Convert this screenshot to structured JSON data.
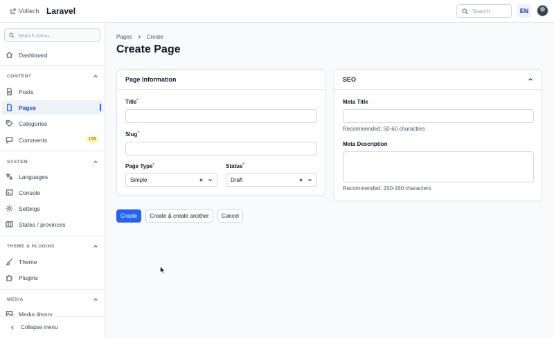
{
  "topbar": {
    "site_link": "Voltech",
    "brand": "Laravel",
    "search_placeholder": "Search",
    "language": "EN"
  },
  "sidebar": {
    "search_placeholder": "Search menu...",
    "dashboard": "Dashboard",
    "groups": {
      "content": "CONTENT",
      "system": "SYSTEM",
      "theme": "THEME & PLUGINS",
      "media": "MEDIA"
    },
    "items": {
      "posts": "Posts",
      "pages": "Pages",
      "categories": "Categories",
      "comments": "Comments",
      "comments_count": "156",
      "languages": "Languages",
      "console": "Console",
      "settings": "Settings",
      "states": "States / provinces",
      "theme": "Theme",
      "plugins": "Plugins",
      "media_library": "Media library"
    },
    "collapse": "Collapse menu"
  },
  "breadcrumb": {
    "parent": "Pages",
    "current": "Create"
  },
  "page_title": "Create Page",
  "page_info": {
    "heading": "Page Information",
    "title_label": "Title",
    "title_value": "",
    "slug_label": "Slug",
    "slug_value": "",
    "required_mark": "*",
    "page_type_label": "Page Type",
    "page_type_value": "Simple",
    "status_label": "Status",
    "status_value": "Draft"
  },
  "seo": {
    "heading": "SEO",
    "meta_title_label": "Meta Title",
    "meta_title_hint": "Recommended: 50-60 characters",
    "meta_desc_label": "Meta Description",
    "meta_desc_hint": "Recommended: 150-160 characters"
  },
  "actions": {
    "create": "Create",
    "create_another": "Create & create another",
    "cancel": "Cancel"
  },
  "colors": {
    "accent": "#2563eb",
    "active_bg": "#eef2f7",
    "required": "#dc2626"
  }
}
